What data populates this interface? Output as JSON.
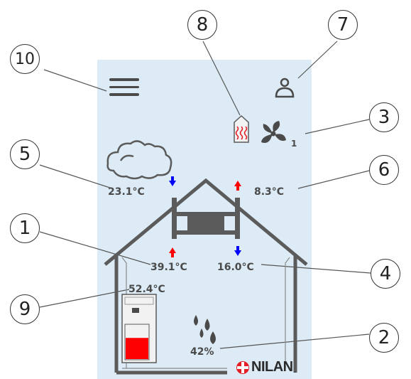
{
  "colors": {
    "screen_bg": "#dcebf5",
    "house_line": "#5b5b5b",
    "hot_arrow": "#ff0000",
    "cold_arrow": "#0000ff",
    "tank_fill": "#ff0000",
    "brand_red": "#e41e26"
  },
  "readings": {
    "supply_air_temp": "39.1°C",
    "humidity": "42%",
    "fan_level": "1",
    "extract_air_temp": "16.0°C",
    "outdoor_air_temp": "23.1°C",
    "exhaust_air_temp": "8.3°C",
    "hot_water_temp": "52.4°C"
  },
  "hot_water_tank_fill_fraction": 0.62,
  "brand": {
    "name": "NILAN",
    "suffix": "."
  },
  "callouts": {
    "c1": "1",
    "c2": "2",
    "c3": "3",
    "c4": "4",
    "c5": "5",
    "c6": "6",
    "c7": "7",
    "c8": "8",
    "c9": "9",
    "c10": "10"
  },
  "icons": {
    "menu": "hamburger-menu-icon",
    "user": "user-icon",
    "heater": "heating-element-icon",
    "fan": "fan-icon",
    "weather": "cloud-icon",
    "humidity": "water-drops-icon",
    "heat_exchanger": "heat-exchanger-icon",
    "tank": "hot-water-tank-icon"
  }
}
